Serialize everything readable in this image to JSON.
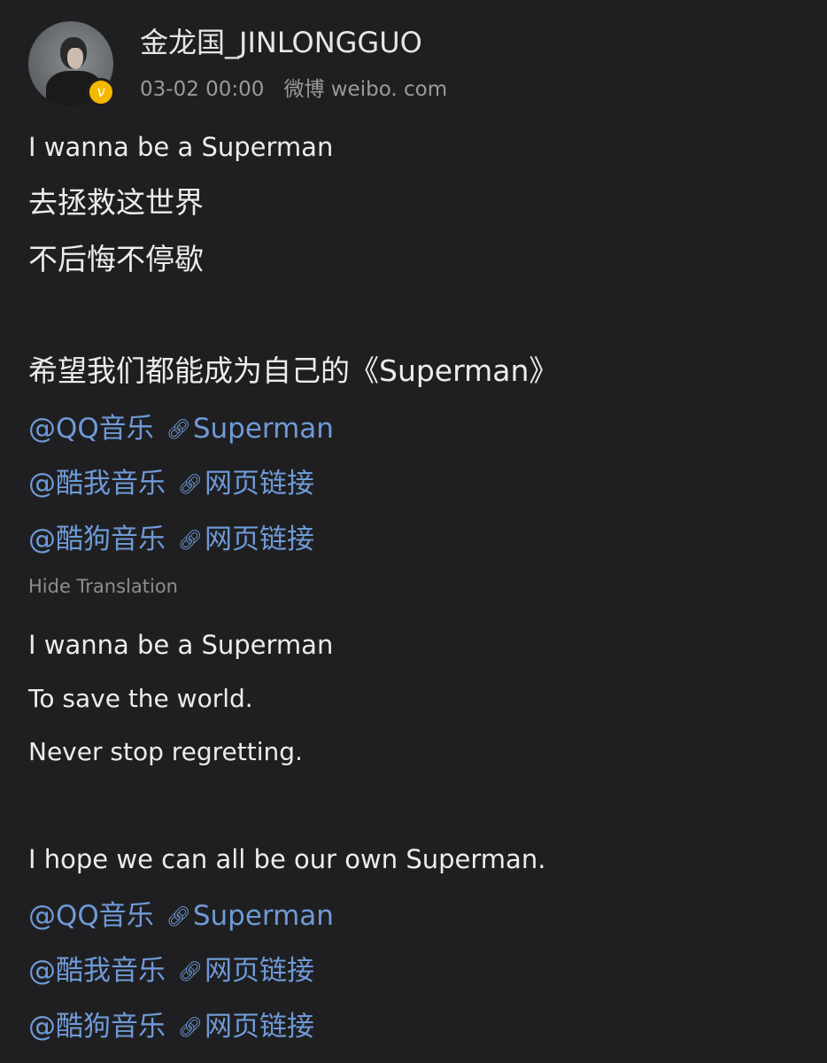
{
  "post": {
    "username": "金龙国_JINLONGGUO",
    "timestamp": "03-02 00:00",
    "source": "微博 weibo. com",
    "verified_badge": "v"
  },
  "original": {
    "lines": [
      "I wanna be a Superman",
      "去拯救这世界",
      "不后悔不停歇",
      "希望我们都能成为自己的《Superman》"
    ],
    "links": [
      {
        "mention": "@QQ音乐",
        "link_text": "Superman"
      },
      {
        "mention": "@酷我音乐",
        "link_text": "网页链接"
      },
      {
        "mention": "@酷狗音乐",
        "link_text": "网页链接"
      }
    ]
  },
  "hide_translation_label": "Hide Translation",
  "translation": {
    "lines": [
      "I wanna be a Superman",
      "To save the world.",
      "Never stop regretting.",
      "I hope we can all be our own Superman."
    ],
    "links": [
      {
        "mention": "@QQ音乐",
        "link_text": "Superman"
      },
      {
        "mention": "@酷我音乐",
        "link_text": "网页链接"
      },
      {
        "mention": "@酷狗音乐",
        "link_text": "网页链接"
      }
    ]
  },
  "icons": {
    "link": "link-icon"
  },
  "colors": {
    "background": "#1f1f21",
    "link": "#6f9ad6",
    "text": "#ececec",
    "muted": "#9a9a9c",
    "verified": "#f5b800"
  }
}
